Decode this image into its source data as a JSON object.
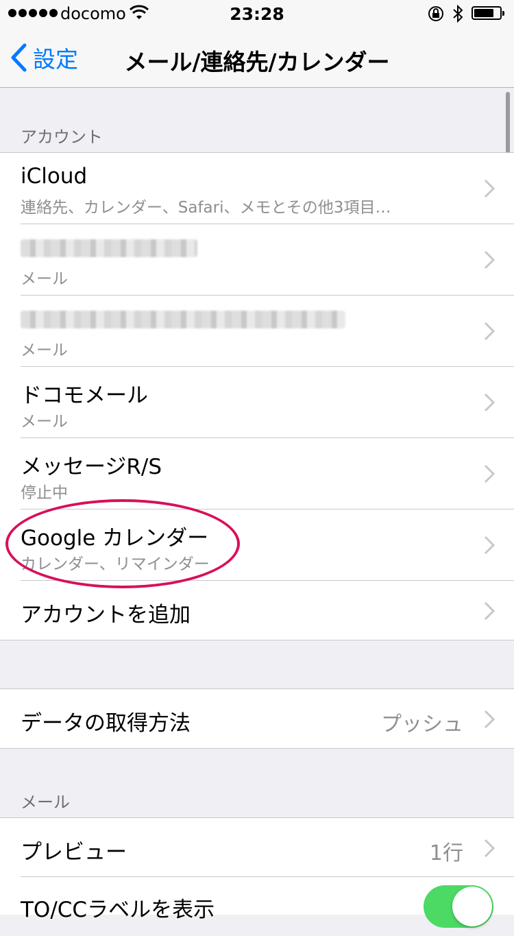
{
  "status_bar": {
    "carrier": "docomo",
    "time": "23:28",
    "icons": [
      "signal-dots-icon",
      "wifi-icon",
      "rotation-lock-icon",
      "bluetooth-icon",
      "battery-icon"
    ]
  },
  "nav": {
    "back_label": "設定",
    "title": "メール/連絡先/カレンダー"
  },
  "accounts_section": {
    "header": "アカウント",
    "items": [
      {
        "title": "iCloud",
        "subtitle": "連絡先、カレンダー、Safari、メモとその他3項目…"
      },
      {
        "title": "",
        "subtitle": "メール"
      },
      {
        "title": "",
        "subtitle": "メール"
      },
      {
        "title": "ドコモメール",
        "subtitle": "メール"
      },
      {
        "title": "メッセージR/S",
        "subtitle": "停止中"
      },
      {
        "title": "Google カレンダー",
        "subtitle": "カレンダー、リマインダー"
      },
      {
        "title": "アカウントを追加"
      }
    ]
  },
  "fetch_section": {
    "title": "データの取得方法",
    "value": "プッシュ"
  },
  "mail_section": {
    "header": "メール",
    "preview": {
      "title": "プレビュー",
      "value": "1行"
    },
    "show_to_cc": {
      "title": "TO/CCラベルを表示",
      "on": true
    }
  },
  "colors": {
    "accent": "#007aff",
    "highlight": "#d7105a",
    "toggle_on": "#4cd964"
  }
}
